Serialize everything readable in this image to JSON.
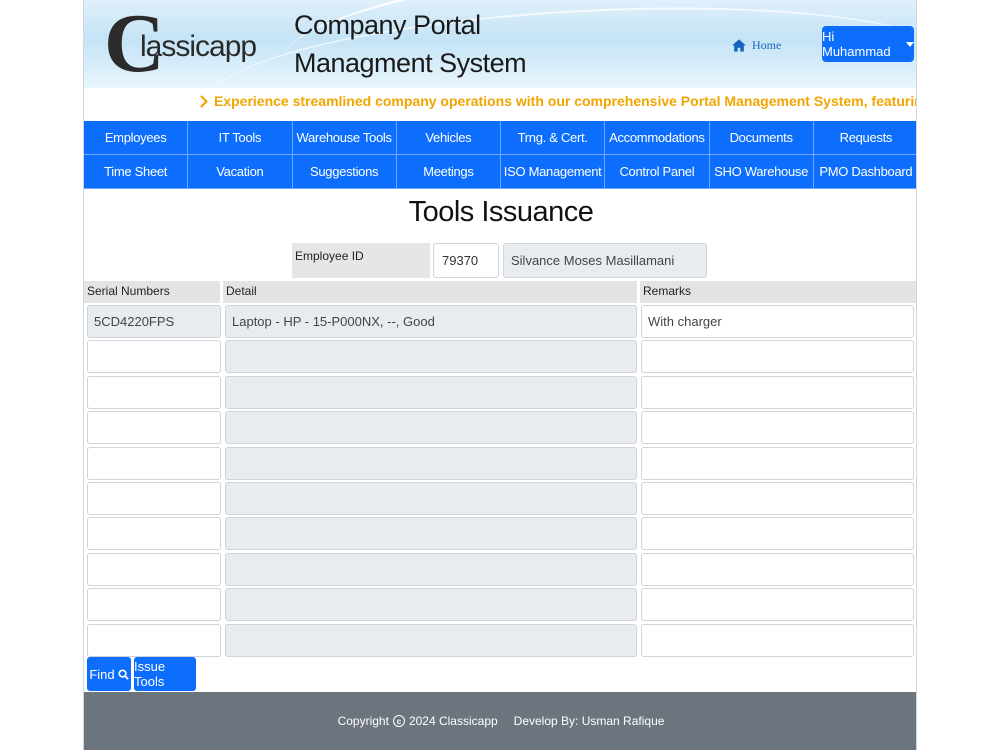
{
  "header": {
    "logo": "Classicapp",
    "title_line1": "Company Portal",
    "title_line2": "Managment System",
    "home_label": "Home",
    "home_icon": "home-icon",
    "user_label": "Hi Muhammad"
  },
  "marquee": {
    "text": "Experience streamlined company operations with our comprehensive Portal Management System, featuring modules for Emplo",
    "icon": "chevron-right-icon"
  },
  "nav": {
    "items": [
      "Employees",
      "IT Tools",
      "Warehouse Tools",
      "Vehicles",
      "Trng. & Cert.",
      "Accommodations",
      "Documents",
      "Requests",
      "Time Sheet",
      "Vacation",
      "Suggestions",
      "Meetings",
      "ISO Management",
      "Control Panel",
      "SHO Warehouse",
      "PMO Dashboard"
    ]
  },
  "page": {
    "title": "Tools Issuance"
  },
  "employee": {
    "label": "Employee ID",
    "id": "79370",
    "name": "Silvance Moses Masillamani"
  },
  "table": {
    "headers": {
      "serial": "Serial Numbers",
      "detail": "Detail",
      "remarks": "Remarks"
    },
    "rows": [
      {
        "serial": "5CD4220FPS",
        "detail": "Laptop - HP - 15-P000NX, --, Good",
        "remarks": "With charger"
      },
      {
        "serial": "",
        "detail": "",
        "remarks": ""
      },
      {
        "serial": "",
        "detail": "",
        "remarks": ""
      },
      {
        "serial": "",
        "detail": "",
        "remarks": ""
      },
      {
        "serial": "",
        "detail": "",
        "remarks": ""
      },
      {
        "serial": "",
        "detail": "",
        "remarks": ""
      },
      {
        "serial": "",
        "detail": "",
        "remarks": ""
      },
      {
        "serial": "",
        "detail": "",
        "remarks": ""
      },
      {
        "serial": "",
        "detail": "",
        "remarks": ""
      },
      {
        "serial": "",
        "detail": "",
        "remarks": ""
      }
    ]
  },
  "buttons": {
    "find": "Find",
    "find_icon": "search-icon",
    "issue": "Issue Tools"
  },
  "footer": {
    "copyright": "Copyright",
    "year_company": "2024 Classicapp",
    "developer": "Develop By:  Usman Rafique"
  },
  "colors": {
    "primary": "#0d6efd",
    "marquee": "#f0a500",
    "footer": "#6c757d",
    "readonly": "#e9ecef"
  }
}
